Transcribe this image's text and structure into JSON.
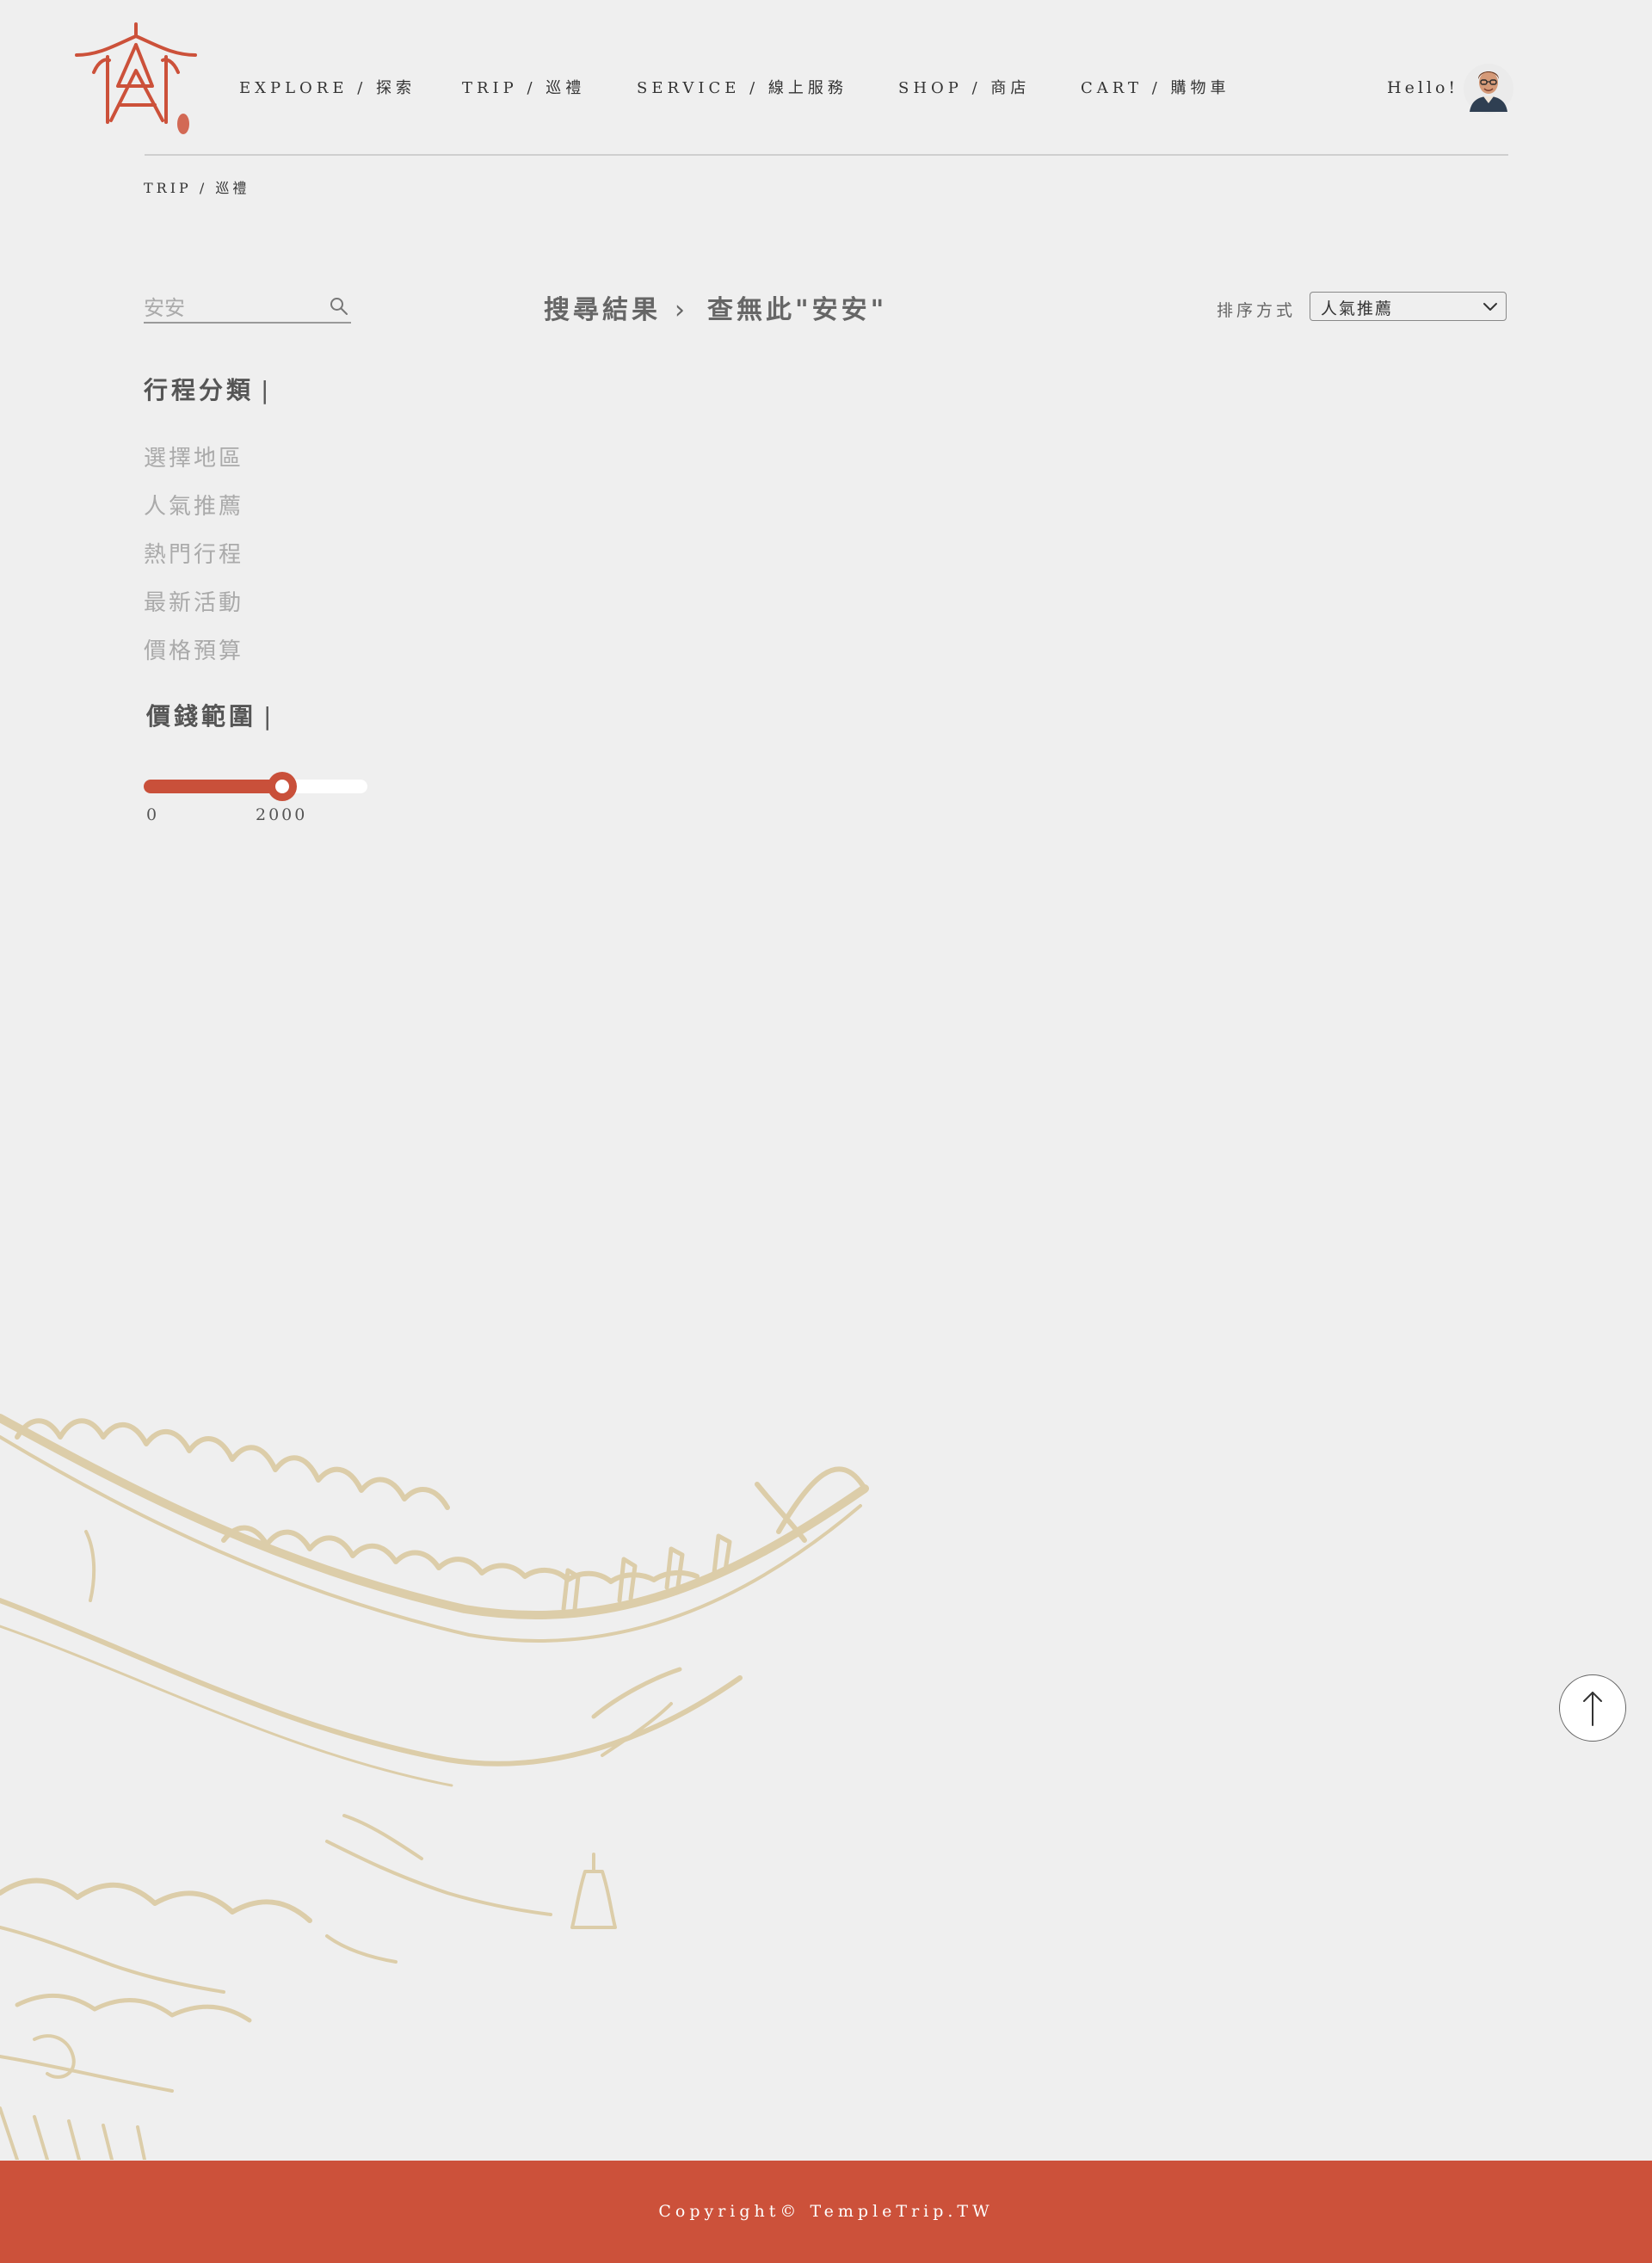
{
  "brand": {
    "accent_color": "#cc513a",
    "logo_icon": "temple-logo-icon"
  },
  "nav": {
    "items": [
      {
        "label": "EXPLORE / 探索"
      },
      {
        "label": "TRIP / 巡禮"
      },
      {
        "label": "SERVICE / 線上服務"
      },
      {
        "label": "SHOP / 商店"
      },
      {
        "label": "CART / 購物車"
      }
    ],
    "greeting": "Hello!"
  },
  "breadcrumb": "TRIP / 巡禮",
  "sidebar": {
    "search": {
      "value": "安安",
      "placeholder": ""
    },
    "category_title": "行程分類",
    "categories": [
      "選擇地區",
      "人氣推薦",
      "熱門行程",
      "最新活動",
      "價格預算"
    ],
    "price_title": "價錢範圍",
    "price_range": {
      "min_label": "0",
      "max_label": "2000",
      "value_fraction": 0.62
    }
  },
  "main": {
    "results_label": "搜尋結果",
    "chevron": "›",
    "no_result_text": "查無此\"安安\"",
    "sort": {
      "label": "排序方式",
      "selected": "人氣推薦"
    }
  },
  "footer": {
    "copyright": "Copyright© TempleTrip.TW"
  }
}
